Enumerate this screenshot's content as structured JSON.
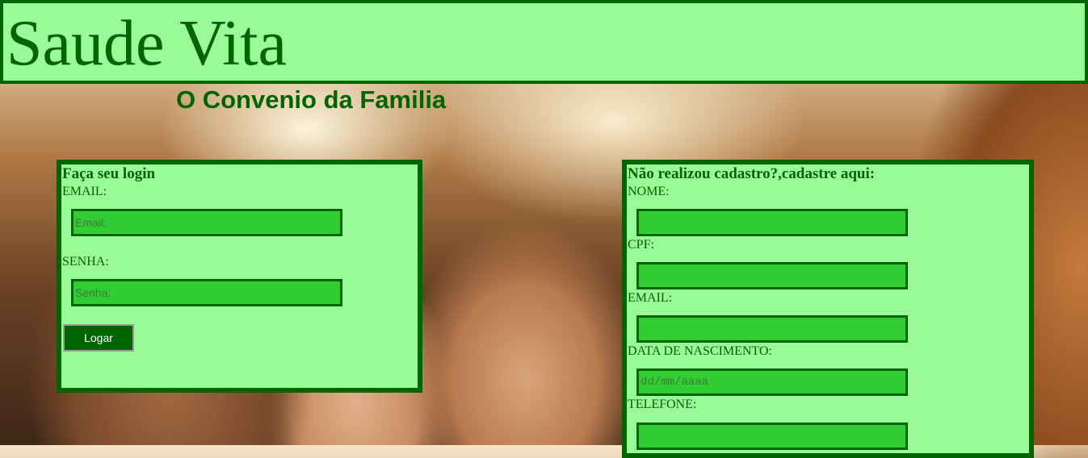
{
  "header": {
    "title": "Saude Vita"
  },
  "subtitle": "O Convenio da Familia",
  "colors": {
    "panel": "#98fb98",
    "border": "#006400",
    "input": "#32cd32"
  },
  "login": {
    "heading": "Faça seu login",
    "email_label": "EMAIL:",
    "email_placeholder": "Email:",
    "password_label": "SENHA:",
    "password_placeholder": "Senha:",
    "button_label": "Logar"
  },
  "register": {
    "heading": "Não realizou cadastro?,cadastre aqui:",
    "name_label": "NOME:",
    "cpf_label": "CPF:",
    "email_label": "EMAIL:",
    "birth_label": "DATA DE NASCIMENTO:",
    "birth_placeholder": "dd/mm/aaaa",
    "phone_label": "TELEFONE:"
  }
}
